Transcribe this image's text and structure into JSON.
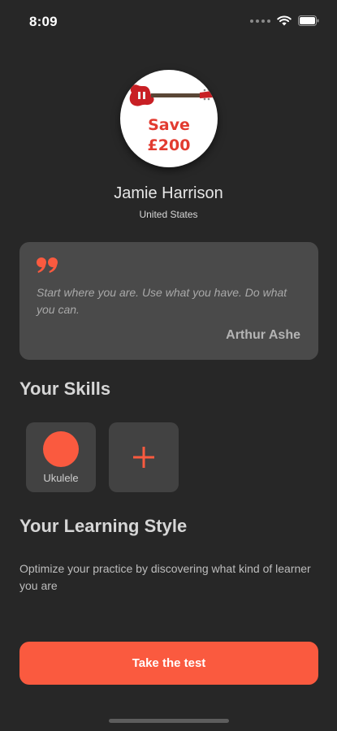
{
  "status_bar": {
    "time": "8:09"
  },
  "profile": {
    "avatar_line1": "Save",
    "avatar_line2": "£200",
    "name": "Jamie Harrison",
    "country": "United States"
  },
  "quote": {
    "text": "Start where you are. Use what you have. Do what you can.",
    "author": "Arthur Ashe"
  },
  "skills": {
    "title": "Your Skills",
    "items": [
      {
        "label": "Ukulele",
        "icon": "ukulele-dot-icon"
      }
    ],
    "add_icon": "plus-icon"
  },
  "learning_style": {
    "title": "Your Learning Style",
    "description": "Optimize your practice by discovering what kind of learner you are"
  },
  "cta": {
    "label": "Take the test"
  },
  "colors": {
    "background": "#272727",
    "card": "#4a4a4a",
    "tile": "#424242",
    "accent": "#fa5a3f"
  }
}
